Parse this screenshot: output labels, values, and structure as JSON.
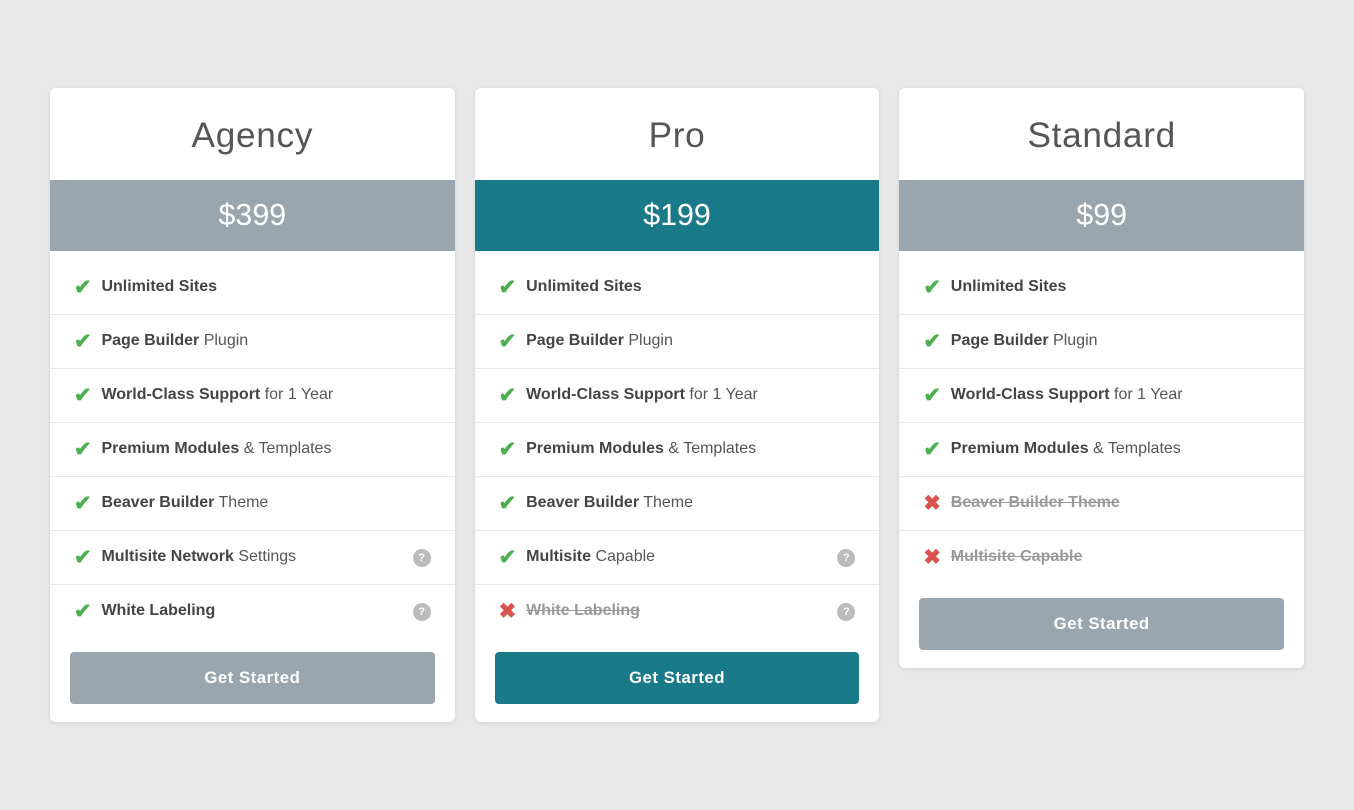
{
  "plans": [
    {
      "id": "agency",
      "name": "Agency",
      "price": "$399",
      "color": "gray",
      "features": [
        {
          "included": true,
          "bold": "Unlimited Sites",
          "rest": "",
          "strikethrough": false,
          "help": false
        },
        {
          "included": true,
          "bold": "Page Builder",
          "rest": " Plugin",
          "strikethrough": false,
          "help": false
        },
        {
          "included": true,
          "bold": "World-Class Support",
          "rest": " for 1 Year",
          "strikethrough": false,
          "help": false
        },
        {
          "included": true,
          "bold": "Premium Modules",
          "rest": " & Templates",
          "strikethrough": false,
          "help": false
        },
        {
          "included": true,
          "bold": "Beaver Builder",
          "rest": " Theme",
          "strikethrough": false,
          "help": false
        },
        {
          "included": true,
          "bold": "Multisite Network",
          "rest": " Settings",
          "strikethrough": false,
          "help": true
        },
        {
          "included": true,
          "bold": "White Labeling",
          "rest": "",
          "strikethrough": false,
          "help": true
        }
      ],
      "cta": "Get Started"
    },
    {
      "id": "pro",
      "name": "Pro",
      "price": "$199",
      "color": "teal",
      "features": [
        {
          "included": true,
          "bold": "Unlimited Sites",
          "rest": "",
          "strikethrough": false,
          "help": false
        },
        {
          "included": true,
          "bold": "Page Builder",
          "rest": " Plugin",
          "strikethrough": false,
          "help": false
        },
        {
          "included": true,
          "bold": "World-Class Support",
          "rest": " for 1 Year",
          "strikethrough": false,
          "help": false
        },
        {
          "included": true,
          "bold": "Premium Modules",
          "rest": " & Templates",
          "strikethrough": false,
          "help": false
        },
        {
          "included": true,
          "bold": "Beaver Builder",
          "rest": " Theme",
          "strikethrough": false,
          "help": false
        },
        {
          "included": true,
          "bold": "Multisite",
          "rest": " Capable",
          "strikethrough": false,
          "help": true
        },
        {
          "included": false,
          "bold": "White Labeling",
          "rest": "",
          "strikethrough": true,
          "help": true
        }
      ],
      "cta": "Get Started"
    },
    {
      "id": "standard",
      "name": "Standard",
      "price": "$99",
      "color": "gray",
      "features": [
        {
          "included": true,
          "bold": "Unlimited Sites",
          "rest": "",
          "strikethrough": false,
          "help": false
        },
        {
          "included": true,
          "bold": "Page Builder",
          "rest": " Plugin",
          "strikethrough": false,
          "help": false
        },
        {
          "included": true,
          "bold": "World-Class Support",
          "rest": " for 1 Year",
          "strikethrough": false,
          "help": false
        },
        {
          "included": true,
          "bold": "Premium Modules",
          "rest": " & Templates",
          "strikethrough": false,
          "help": false
        },
        {
          "included": false,
          "bold": "Beaver Builder Theme",
          "rest": "",
          "strikethrough": true,
          "help": false
        },
        {
          "included": false,
          "bold": "Multisite Capable",
          "rest": "",
          "strikethrough": true,
          "help": false
        }
      ],
      "cta": "Get Started"
    }
  ],
  "icons": {
    "check": "✔",
    "cross": "✖",
    "help": "?"
  }
}
